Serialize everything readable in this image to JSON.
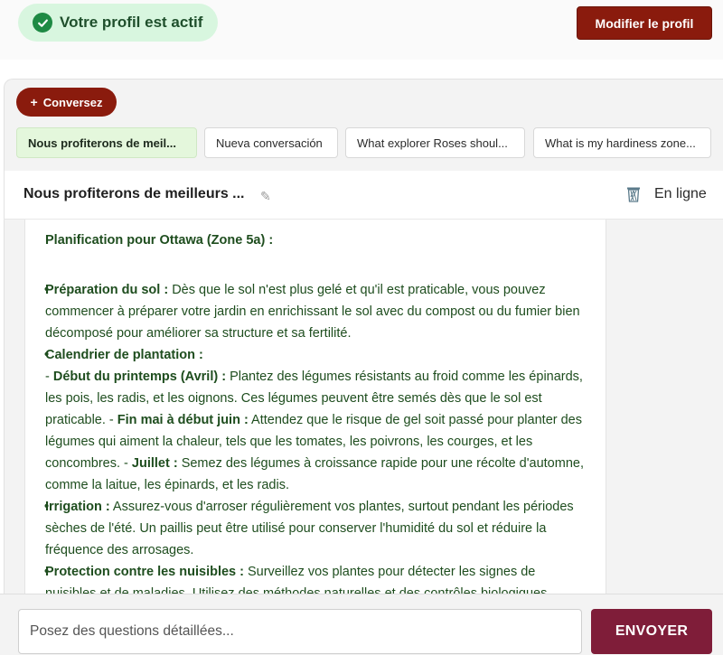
{
  "profile": {
    "status_text": "Votre profil est actif",
    "edit_label": "Modifier le profil"
  },
  "conversations": {
    "new_label": "Conversez",
    "tabs": [
      {
        "label": "Nous profiterons de meil...",
        "active": true
      },
      {
        "label": "Nueva conversación",
        "active": false
      },
      {
        "label": "What explorer Roses shoul...",
        "active": false
      },
      {
        "label": "What is my hardiness zone...",
        "active": false
      }
    ]
  },
  "chat": {
    "title": "Nous profiterons de meilleurs ...",
    "status": "En ligne",
    "message": {
      "heading": "Planification pour Ottawa (Zone 5a) :",
      "items": [
        {
          "label": "Préparation du sol :",
          "text": " Dès que le sol n'est plus gelé et qu'il est praticable, vous pouvez commencer à préparer votre jardin en enrichissant le sol avec du compost ou du fumier bien décomposé pour améliorer sa structure et sa fertilité."
        },
        {
          "label": "Calendrier de plantation :",
          "sub1_prefix": "- ",
          "sub1_label": "Début du printemps (Avril) :",
          "sub1_text": " Plantez des légumes résistants au froid comme les épinards, les pois, les radis, et les oignons. Ces légumes peuvent être semés dès que le sol est praticable. - ",
          "sub2_label": "Fin mai à début juin :",
          "sub2_text": " Attendez que le risque de gel soit passé pour planter des légumes qui aiment la chaleur, tels que les tomates, les poivrons, les courges, et les concombres. - ",
          "sub3_label": "Juillet :",
          "sub3_text": " Semez des légumes à croissance rapide pour une récolte d'automne, comme la laitue, les épinards, et les radis."
        },
        {
          "label": "Irrigation :",
          "text": " Assurez-vous d'arroser régulièrement vos plantes, surtout pendant les périodes sèches de l'été. Un paillis peut être utilisé pour conserver l'humidité du sol et réduire la fréquence des arrosages."
        },
        {
          "label": "Protection contre les nuisibles :",
          "text": " Surveillez vos plantes pour détecter les signes de nuisibles et de maladies. Utilisez des méthodes naturelles et des contrôles biologiques"
        }
      ]
    }
  },
  "composer": {
    "placeholder": "Posez des questions détaillées...",
    "send_label": "ENVOYER"
  },
  "colors": {
    "brand": "#8a1b0d",
    "send": "#7f1d39",
    "active_pill": "#d8f6df",
    "message_text": "#1e4d1e"
  }
}
